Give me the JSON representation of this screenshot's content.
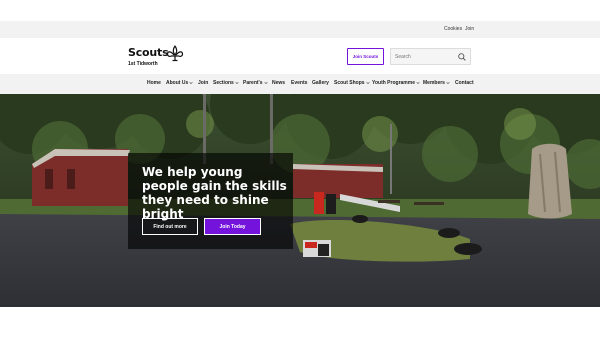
{
  "utility": {
    "cookies": "Cookies",
    "join": "Join"
  },
  "brand": {
    "name": "Scouts",
    "group": "1st Tidworth",
    "accent": "#7413dc"
  },
  "header": {
    "join_button": "Join Scouts",
    "search_placeholder": "Search",
    "search_icon": "search-icon"
  },
  "nav": {
    "items": [
      {
        "label": "Home",
        "dropdown": false
      },
      {
        "label": "About Us",
        "dropdown": true
      },
      {
        "label": "Join",
        "dropdown": false
      },
      {
        "label": "Sections",
        "dropdown": true
      },
      {
        "label": "Parent's",
        "dropdown": true
      },
      {
        "label": "News",
        "dropdown": false
      },
      {
        "label": "Events",
        "dropdown": false
      },
      {
        "label": "Gallery",
        "dropdown": false
      },
      {
        "label": "Scout Shops",
        "dropdown": true
      },
      {
        "label": "Youth Programme",
        "dropdown": true
      },
      {
        "label": "Members",
        "dropdown": true
      },
      {
        "label": "Contact",
        "dropdown": false
      }
    ]
  },
  "hero": {
    "heading": "We help young people gain the skills they need to shine bright",
    "find_out_more": "Find out more",
    "join_today": "Join Today"
  }
}
